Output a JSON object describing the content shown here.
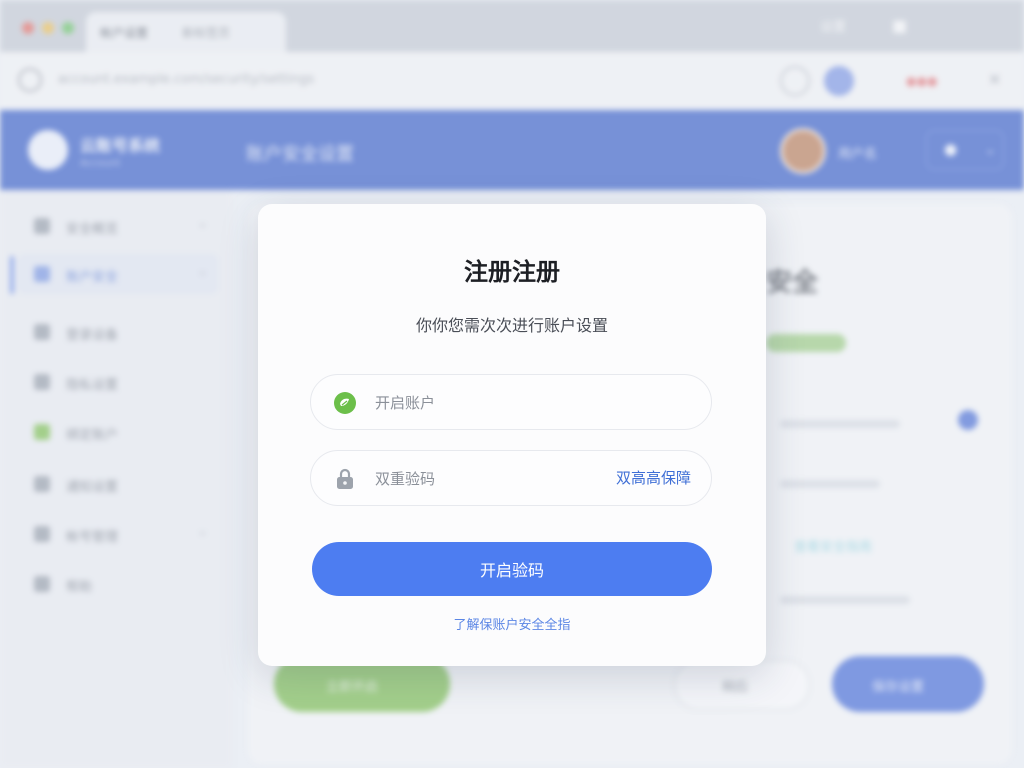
{
  "background": {
    "tabs": [
      {
        "title": "帐户设置"
      },
      {
        "title": "新标签页"
      }
    ],
    "top_right_text": "设置",
    "address_text": "account.example.com/security/settings",
    "header": {
      "brand": "云账号系统",
      "brand_sub": "Account",
      "title": "账户安全设置",
      "user_name": "用户名"
    },
    "sidebar_items": [
      {
        "label": "安全概览"
      },
      {
        "label": "账户安全"
      },
      {
        "label": "登录设备"
      },
      {
        "label": "隐私设置"
      },
      {
        "label": "绑定账户"
      },
      {
        "label": "通知设置"
      },
      {
        "label": "帐号管理"
      },
      {
        "label": "帮助"
      }
    ],
    "heading": "安全",
    "buttons": {
      "green": "立即开启",
      "white": "稍后",
      "blue": "保存设置"
    },
    "link": "查看安全指南"
  },
  "modal": {
    "title": "注册注册",
    "subtitle": "你你您需次次进行账户设置",
    "field_account_placeholder": "开启账户",
    "field_code_placeholder": "双重验码",
    "field_code_action": "双高高保障",
    "primary_button": "开启验码",
    "help_link": "了解保账户安全全指"
  },
  "colors": {
    "primary": "#4d7df1",
    "header_blue": "#3e63c8",
    "accent_green": "#6cbf4a"
  },
  "icons": [
    "account-leaf-icon",
    "lock-icon"
  ]
}
